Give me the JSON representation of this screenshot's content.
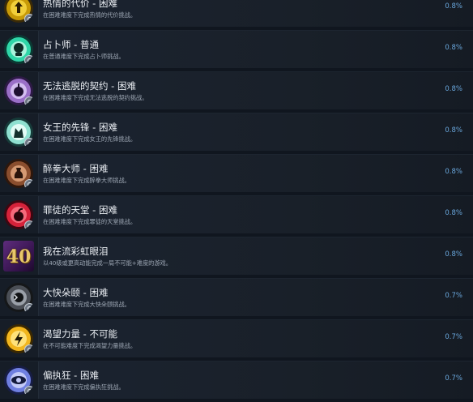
{
  "achievements": [
    {
      "title": "热情的代价 - 困难",
      "desc": "在困难难度下完成热情的代价挑战。",
      "pct": "0.8%",
      "icon": "flame-cost-icon",
      "color": "#e2b400"
    },
    {
      "title": "占卜师 - 普通",
      "desc": "在普通难度下完成占卜师挑战。",
      "pct": "0.8%",
      "icon": "fortune-teller-icon",
      "color": "#2fd6a8"
    },
    {
      "title": "无法逃脱的契约 - 困难",
      "desc": "在困难难度下完成无法逃脱的契约挑战。",
      "pct": "0.8%",
      "icon": "contract-icon",
      "color": "#9a6fc7"
    },
    {
      "title": "女王的先锋 - 困难",
      "desc": "在困难难度下完成女王的先锋挑战。",
      "pct": "0.8%",
      "icon": "queens-vanguard-icon",
      "color": "#8fe0d0"
    },
    {
      "title": "醉拳大师 - 困难",
      "desc": "在困难难度下完成醉拳大师挑战。",
      "pct": "0.8%",
      "icon": "drunken-master-icon",
      "color": "#8a4e2e"
    },
    {
      "title": "罪徒的天堂 - 困难",
      "desc": "在困难难度下完成罪徒的天堂挑战。",
      "pct": "0.8%",
      "icon": "sinners-paradise-icon",
      "color": "#d6223a"
    },
    {
      "title": "我在流彩虹眼泪",
      "desc": "以40级或更高动能完成一局不可能+难度的游戏。",
      "pct": "0.8%",
      "icon": "level-40-icon",
      "color": "#e8c66a"
    },
    {
      "title": "大快朵颐 - 困难",
      "desc": "在困难难度下完成大快朵颐挑战。",
      "pct": "0.7%",
      "icon": "feast-icon",
      "color": "#4a4e55"
    },
    {
      "title": "渴望力量 - 不可能",
      "desc": "在不可能难度下完成渴望力量挑战。",
      "pct": "0.7%",
      "icon": "lightning-icon",
      "color": "#f2b61e"
    },
    {
      "title": "偏执狂 - 困难",
      "desc": "在困难难度下完成偏执狂挑战。",
      "pct": "0.7%",
      "icon": "paranoid-eye-icon",
      "color": "#6f7fe0"
    }
  ]
}
